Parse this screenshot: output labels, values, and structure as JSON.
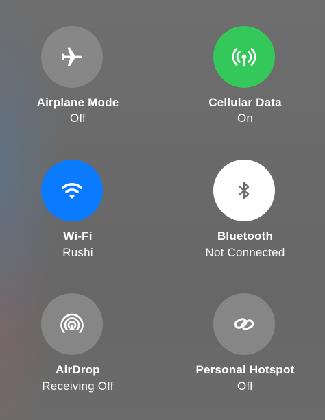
{
  "toggles": [
    {
      "label": "Airplane Mode",
      "status": "Off",
      "icon": "airplane-icon",
      "color": "#8c8c8c"
    },
    {
      "label": "Cellular Data",
      "status": "On",
      "icon": "antenna-icon",
      "color": "#34c759"
    },
    {
      "label": "Wi-Fi",
      "status": "Rushi",
      "icon": "wifi-icon",
      "color": "#0a7aff"
    },
    {
      "label": "Bluetooth",
      "status": "Not Connected",
      "icon": "bluetooth-icon",
      "color": "#ffffff"
    },
    {
      "label": "AirDrop",
      "status": "Receiving Off",
      "icon": "airdrop-icon",
      "color": "#8c8c8c"
    },
    {
      "label": "Personal Hotspot",
      "status": "Off",
      "icon": "hotspot-icon",
      "color": "#8c8c8c"
    }
  ]
}
